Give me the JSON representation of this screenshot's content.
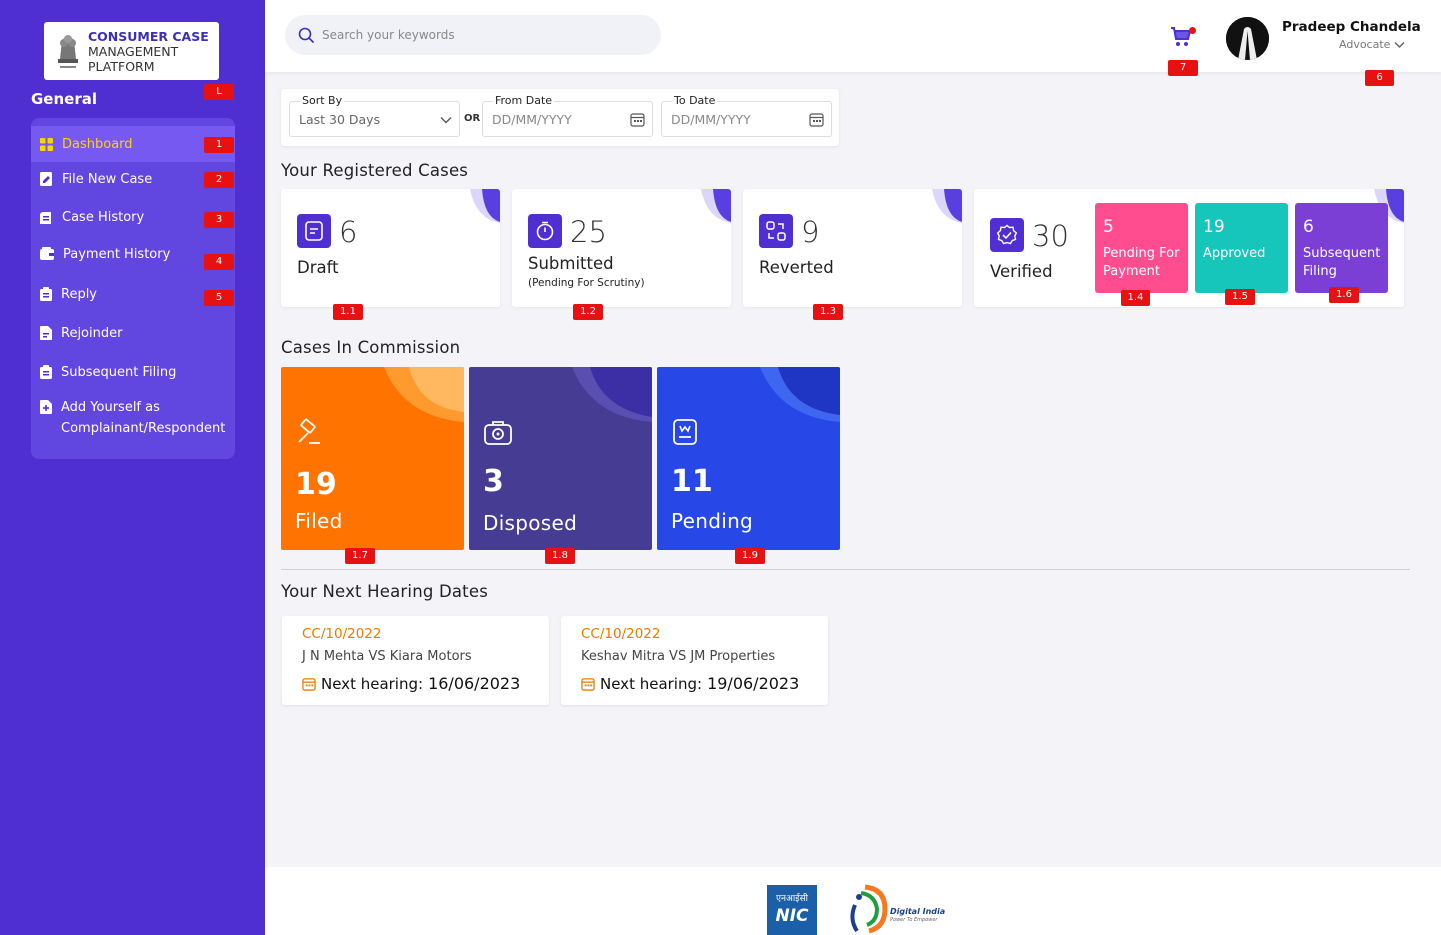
{
  "app": {
    "logo_line1": "CONSUMER CASE",
    "logo_line2": "MANAGEMENT",
    "logo_line3": "PLATFORM"
  },
  "sidebar": {
    "heading": "General",
    "heading_badge": "L",
    "items": [
      {
        "label": "Dashboard",
        "badge": "1",
        "icon": "dashboard-grid-icon"
      },
      {
        "label": "File New Case",
        "badge": "2",
        "icon": "file-edit-icon"
      },
      {
        "label": "Case History",
        "badge": "3",
        "icon": "history-icon"
      },
      {
        "label": "Payment History",
        "badge": "4",
        "icon": "wallet-icon"
      },
      {
        "label": "Reply",
        "badge": "5",
        "icon": "clipboard-icon"
      },
      {
        "label": "Rejoinder",
        "badge": "",
        "icon": "document-icon"
      },
      {
        "label": "Subsequent Filing",
        "badge": "",
        "icon": "clipboard-icon"
      },
      {
        "label": "Add Yourself as",
        "label2": "Complainant/Respondent",
        "badge": "",
        "icon": "add-document-icon"
      }
    ]
  },
  "header": {
    "search_placeholder": "Search your keywords",
    "cart_badge": "7",
    "user_name": "Pradeep Chandela",
    "user_role": "Advocate",
    "user_badge": "6"
  },
  "filters": {
    "sort_label": "Sort By",
    "sort_value": "Last 30 Days",
    "or_text": "OR",
    "from_label": "From Date",
    "from_placeholder": "DD/MM/YYYY",
    "to_label": "To Date",
    "to_placeholder": "DD/MM/YYYY"
  },
  "registered": {
    "title": "Your Registered Cases",
    "draft": {
      "count": "6",
      "label": "Draft",
      "badge": "1.1"
    },
    "submitted": {
      "count": "25",
      "label": "Submitted",
      "sub": "(Pending For Scrutiny)",
      "badge": "1.2"
    },
    "reverted": {
      "count": "9",
      "label": "Reverted",
      "badge": "1.3"
    },
    "verified": {
      "count": "30",
      "label": "Verified"
    },
    "pending_payment": {
      "count": "5",
      "label1": "Pending For",
      "label2": "Payment",
      "badge": "1.4",
      "color": "#ff4d8f"
    },
    "approved": {
      "count": "19",
      "label": "Approved",
      "badge": "1.5",
      "color": "#17c6bb"
    },
    "subsequent": {
      "count": "6",
      "label1": "Subsequent",
      "label2": "Filing",
      "badge": "1.6",
      "color": "#7b3fd6"
    }
  },
  "commission": {
    "title": "Cases In Commission",
    "filed": {
      "count": "19",
      "label": "Filed",
      "badge": "1.7",
      "color": "#ff7300"
    },
    "disposed": {
      "count": "3",
      "label": "Disposed",
      "badge": "1.8",
      "color": "#473c93"
    },
    "pending": {
      "count": "11",
      "label": "Pending",
      "badge": "1.9",
      "color": "#2748e6"
    }
  },
  "hearings": {
    "title": "Your Next Hearing Dates",
    "items": [
      {
        "case": "CC/10/2022",
        "parties": "J N Mehta VS Kiara Motors",
        "prefix": "Next hearing:",
        "date": "16/06/2023"
      },
      {
        "case": "CC/10/2022",
        "parties": "Keshav Mitra VS JM Properties",
        "prefix": "Next hearing:",
        "date": "19/06/2023"
      }
    ]
  },
  "footer": {
    "nic_hindi": "एनआईसी",
    "nic_text": "NIC",
    "digital_india": "Digital India",
    "digital_india_tag": "Power To Empower"
  }
}
